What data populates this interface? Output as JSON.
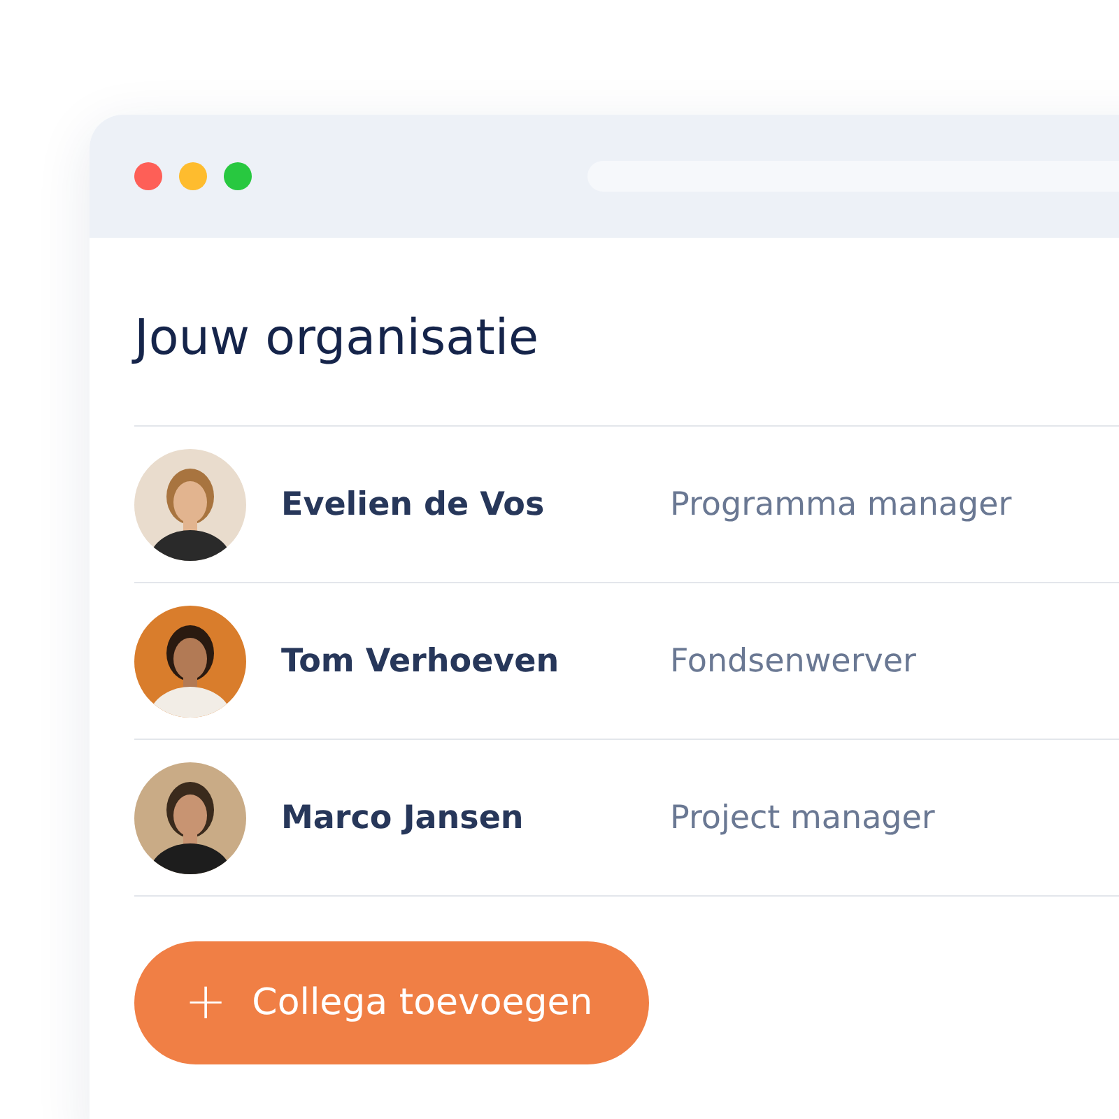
{
  "heading": "Jouw organisatie",
  "members": [
    {
      "name": "Evelien de Vos",
      "role": "Programma manager"
    },
    {
      "name": "Tom Verhoeven",
      "role": "Fondsenwerver"
    },
    {
      "name": "Marco Jansen",
      "role": "Project manager"
    }
  ],
  "add_button": {
    "icon": "+",
    "label": "Collega toevoegen"
  }
}
